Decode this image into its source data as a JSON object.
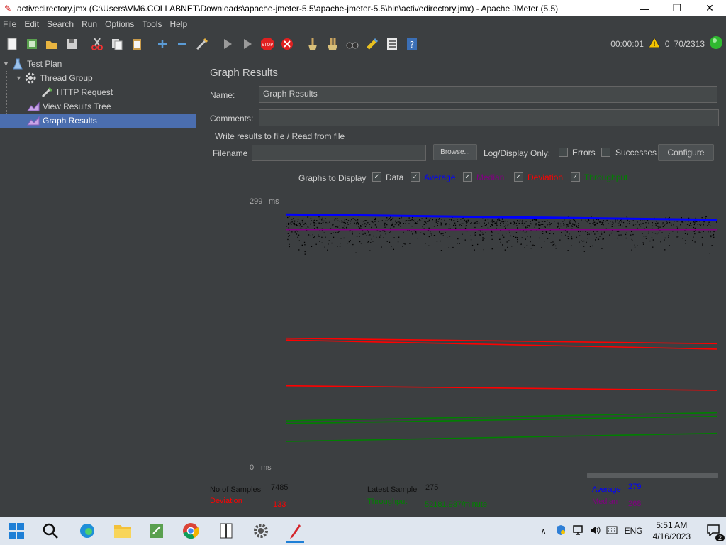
{
  "window": {
    "title": "activedirectory.jmx (C:\\Users\\VM6.COLLABNET\\Downloads\\apache-jmeter-5.5\\apache-jmeter-5.5\\bin\\activedirectory.jmx) - Apache JMeter (5.5)",
    "minimize": "—",
    "maximize": "❐",
    "close": "✕"
  },
  "menu": [
    "File",
    "Edit",
    "Search",
    "Run",
    "Options",
    "Tools",
    "Help"
  ],
  "status": {
    "elapsed": "00:00:01",
    "warnings": "0",
    "threads": "70/2313"
  },
  "tree": [
    {
      "label": "Test Plan",
      "icon": "flask-icon"
    },
    {
      "label": "Thread Group",
      "icon": "gear-icon"
    },
    {
      "label": "HTTP Request",
      "icon": "pipette-icon"
    },
    {
      "label": "View Results Tree",
      "icon": "graph-icon"
    },
    {
      "label": "Graph Results",
      "icon": "graph-icon"
    }
  ],
  "panel": {
    "heading": "Graph Results",
    "name_label": "Name:",
    "name_value": "Graph Results",
    "comments_label": "Comments:",
    "comments_value": "",
    "file_group": "Write results to file / Read from file",
    "filename_label": "Filename",
    "filename_value": "",
    "browse": "Browse...",
    "log_display": "Log/Display Only:",
    "errors": "Errors",
    "successes": "Successes",
    "configure": "Configure",
    "graphs_to_display": "Graphs to Display",
    "series_toggles": [
      {
        "label": "Data",
        "color": "#d0d0d0",
        "checked": true
      },
      {
        "label": "Average",
        "color": "#0000ff",
        "checked": true
      },
      {
        "label": "Median",
        "color": "#800080",
        "checked": true
      },
      {
        "label": "Deviation",
        "color": "#ff0000",
        "checked": true
      },
      {
        "label": "Throughput",
        "color": "#008000",
        "checked": true
      }
    ]
  },
  "chart_data": {
    "type": "line",
    "ylim": [
      0,
      299
    ],
    "y_tick_labels": [
      "299",
      "0"
    ],
    "y_unit": "ms",
    "x": [
      0,
      1
    ],
    "series": [
      {
        "name": "Average",
        "color": "#0000ff",
        "values": [
          283,
          277
        ]
      },
      {
        "name": "Median",
        "color": "#800080",
        "values": [
          266,
          266
        ]
      },
      {
        "name": "Deviation",
        "color": "#ff0000",
        "values": [
          143,
          133
        ]
      },
      {
        "name": "Deviation",
        "color": "#ff0000",
        "values": [
          145,
          139
        ]
      },
      {
        "name": "Deviation",
        "color": "#ff0000",
        "values": [
          92,
          87
        ]
      },
      {
        "name": "Throughput",
        "color": "#008000",
        "values": [
          53,
          62
        ]
      },
      {
        "name": "Throughput",
        "color": "#008000",
        "values": [
          50,
          58
        ]
      },
      {
        "name": "Throughput",
        "color": "#008000",
        "values": [
          30,
          39
        ]
      }
    ]
  },
  "stats": {
    "samples_label": "No of Samples",
    "samples_value": "7485",
    "latest_label": "Latest Sample",
    "latest_value": "275",
    "average_label": "Average",
    "average_value": "279",
    "deviation_label": "Deviation",
    "deviation_value": "133",
    "throughput_label": "Throughput",
    "throughput_value": "52181.937/minute",
    "median_label": "Median",
    "median_value": "268"
  },
  "tray": {
    "lang": "ENG",
    "time": "5:51 AM",
    "date": "4/16/2023",
    "notifications": "2"
  }
}
